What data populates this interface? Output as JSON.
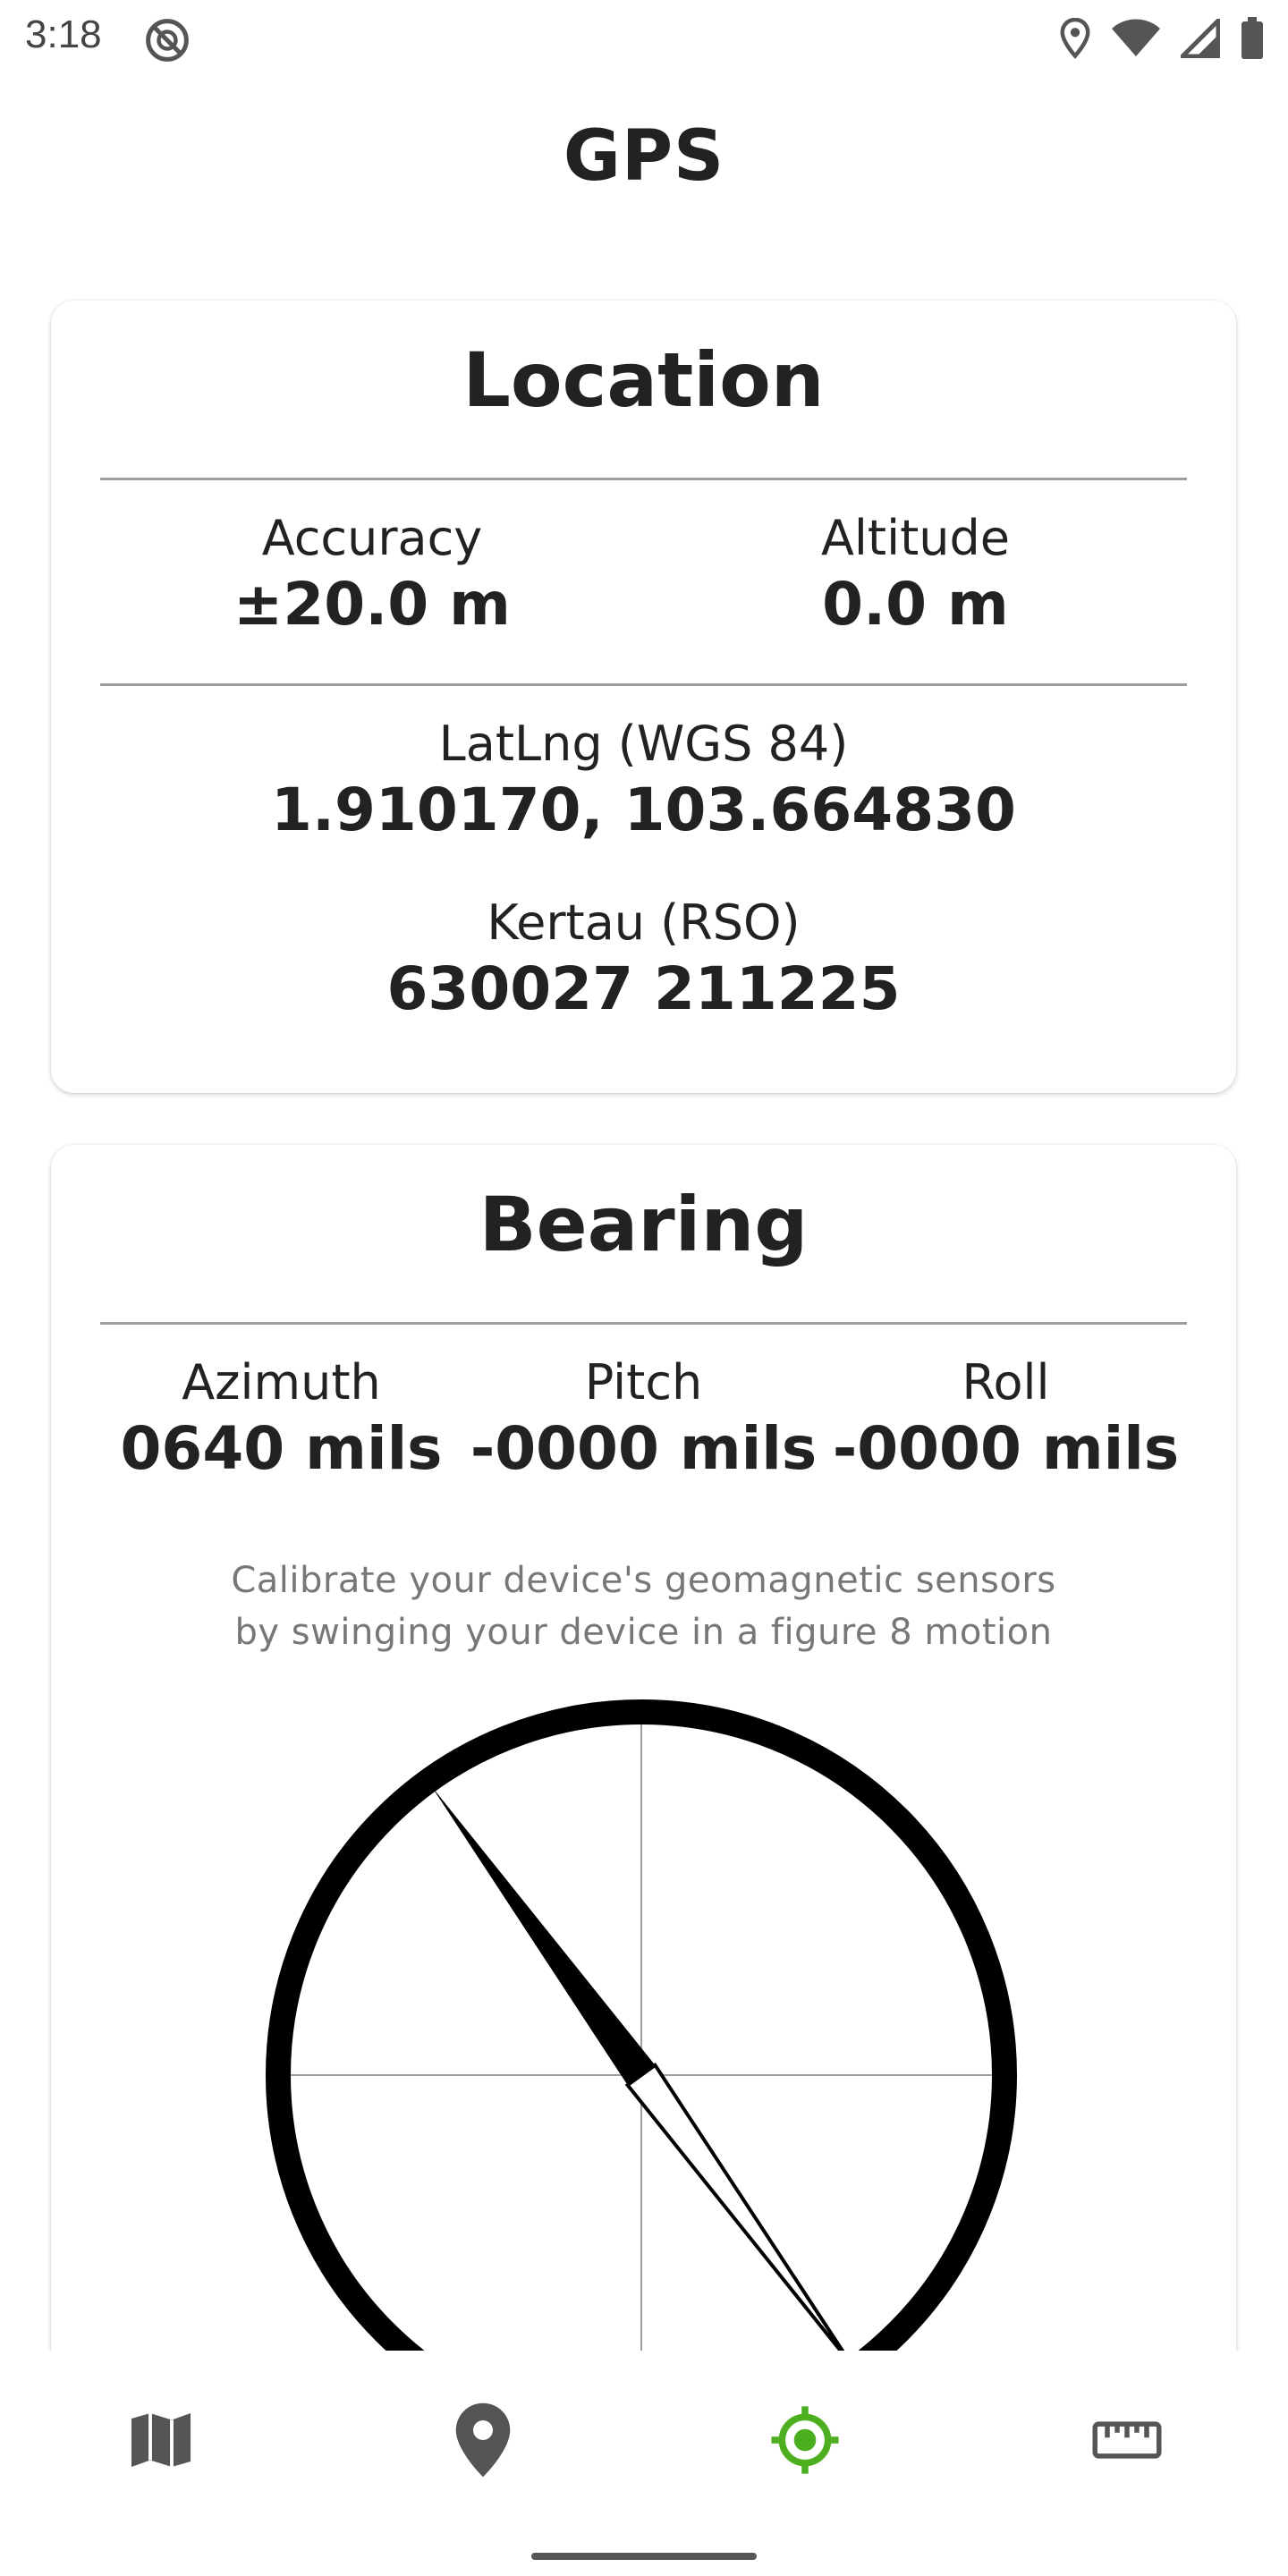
{
  "status_bar": {
    "time": "3:18",
    "icons": [
      "do-not-disturb-icon",
      "location-icon",
      "wifi-icon",
      "cell-signal-icon",
      "battery-icon"
    ]
  },
  "header": {
    "title": "GPS"
  },
  "location_card": {
    "title": "Location",
    "accuracy": {
      "label": "Accuracy",
      "value": "±20.0 m"
    },
    "altitude": {
      "label": "Altitude",
      "value": "0.0 m"
    },
    "latlng": {
      "label": "LatLng (WGS 84)",
      "value": "1.910170, 103.664830"
    },
    "kertau": {
      "label": "Kertau (RSO)",
      "value": "630027 211225"
    }
  },
  "bearing_card": {
    "title": "Bearing",
    "azimuth": {
      "label": "Azimuth",
      "value": "0640 mils"
    },
    "pitch": {
      "label": "Pitch",
      "value": "-0000 mils"
    },
    "roll": {
      "label": "Roll",
      "value": "-0000 mils"
    },
    "hint_line1": "Calibrate your device's geomagnetic sensors",
    "hint_line2": "by swinging your device in a figure 8 motion",
    "compass_azimuth_mils": 640
  },
  "bottom_nav": {
    "items": [
      {
        "icon": "map-icon",
        "active": false
      },
      {
        "icon": "location-pin-icon",
        "active": false
      },
      {
        "icon": "gps-target-icon",
        "active": true
      },
      {
        "icon": "ruler-icon",
        "active": false
      }
    ],
    "active_color": "#4caf1f",
    "inactive_color": "#555555"
  }
}
